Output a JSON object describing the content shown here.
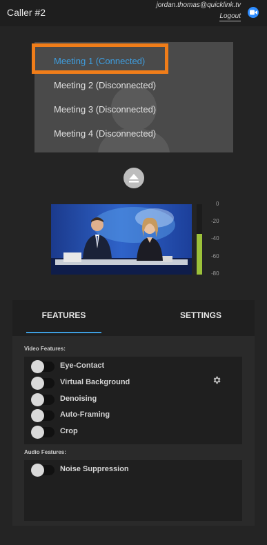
{
  "header": {
    "title": "Caller #2",
    "email": "jordan.thomas@quicklink.tv",
    "logout_label": "Logout",
    "app_icon": "zoom-camera-icon"
  },
  "meetings": [
    {
      "label": "Meeting 1 (Connected)",
      "status": "connected"
    },
    {
      "label": "Meeting 2 (Disconnected)",
      "status": "disconnected"
    },
    {
      "label": "Meeting 3 (Disconnected)",
      "status": "disconnected"
    },
    {
      "label": "Meeting 4 (Disconnected)",
      "status": "disconnected"
    }
  ],
  "meter": {
    "labels": [
      "0",
      "-20",
      "-40",
      "-60",
      "-80"
    ],
    "level_fraction": 0.58,
    "color": "#9cc13a"
  },
  "tabs": {
    "features": "FEATURES",
    "settings": "SETTINGS"
  },
  "video_features": {
    "label": "Video Features:",
    "items": [
      "Eye-Contact",
      "Virtual Background",
      "Denoising",
      "Auto-Framing",
      "Crop"
    ]
  },
  "audio_features": {
    "label": "Audio Features:",
    "items": [
      "Noise Suppression"
    ]
  },
  "colors": {
    "accent": "#3e9ee0",
    "highlight": "#f07d19",
    "meter_green": "#9cc13a"
  }
}
